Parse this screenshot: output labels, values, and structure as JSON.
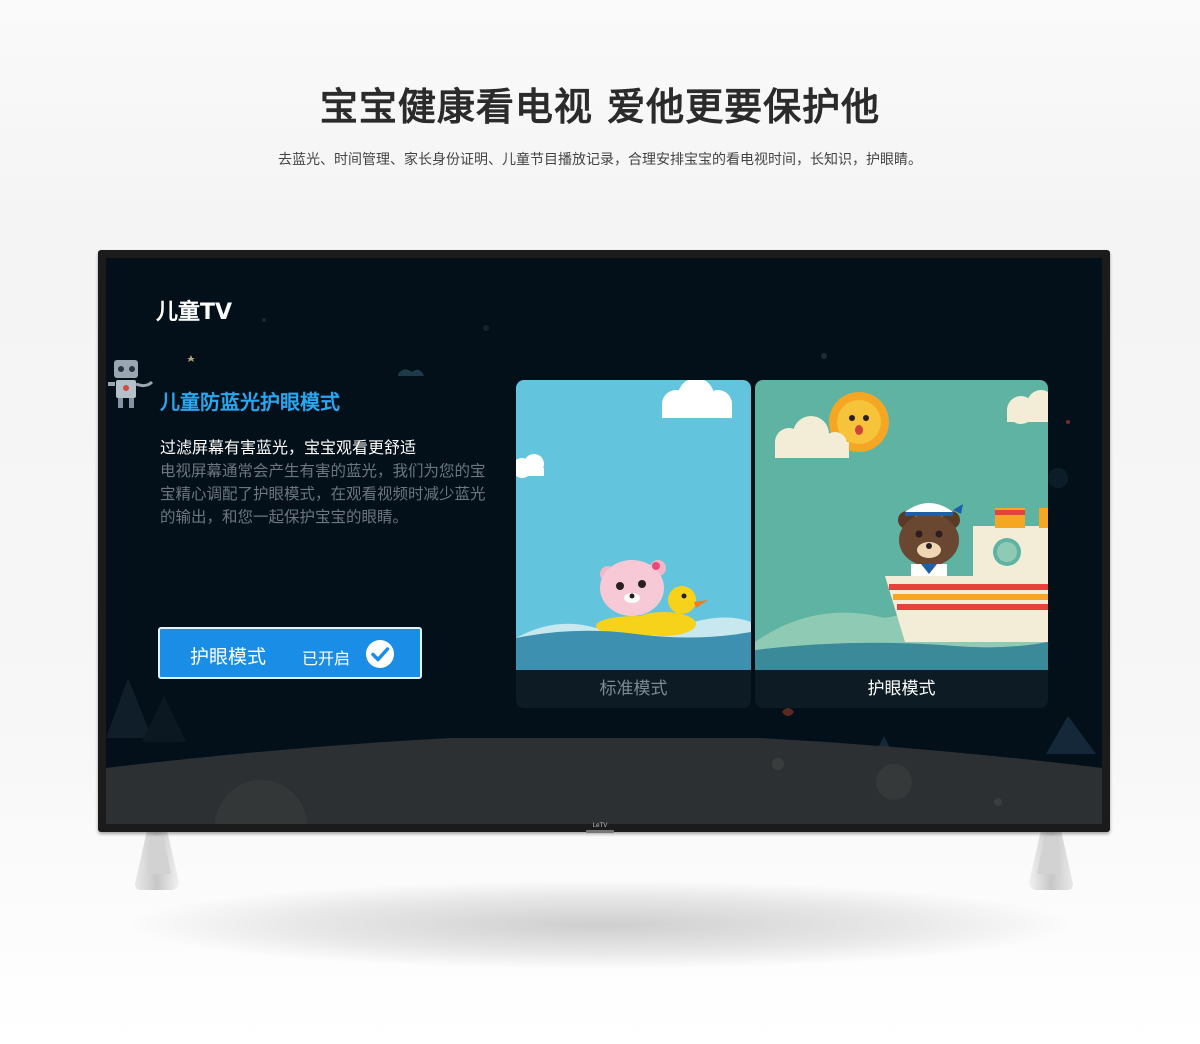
{
  "header": {
    "headline": "宝宝健康看电视 爱他更要保护他",
    "subline": "去蓝光、时间管理、家长身份证明、儿童节目播放记录，合理安排宝宝的看电视时间，长知识，护眼睛。"
  },
  "tv": {
    "brand": "LeTV",
    "app_title": "儿童TV",
    "feature": {
      "title": "儿童防蓝光护眼模式",
      "subtitle": "过滤屏幕有害蓝光，宝宝观看更舒适",
      "description": "电视屏幕通常会产生有害的蓝光，我们为您的宝宝精心调配了护眼模式，在观看视频时减少蓝光的输出，和您一起保护宝宝的眼睛。"
    },
    "toggle": {
      "label": "护眼模式",
      "status": "已开启",
      "enabled": true,
      "icon": "check-circle-icon"
    },
    "modes": [
      {
        "label": "标准模式",
        "selected": false
      },
      {
        "label": "护眼模式",
        "selected": true
      }
    ]
  },
  "colors": {
    "accent": "#2aa6ee",
    "button": "#1a8ee6",
    "screen_bg": "#03101a",
    "standard_sky": "#63c5dd",
    "eye_sky": "#5fb3a3"
  }
}
